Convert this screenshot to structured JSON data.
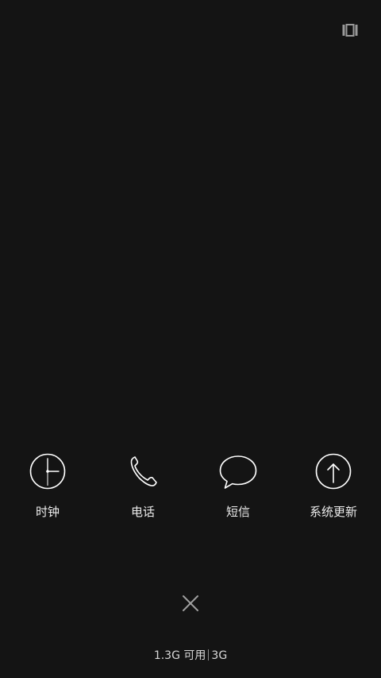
{
  "top_bar": {
    "icon": "app-manager-icon"
  },
  "apps": [
    {
      "label": "时钟",
      "icon": "clock-icon"
    },
    {
      "label": "电话",
      "icon": "phone-icon"
    },
    {
      "label": "短信",
      "icon": "message-icon"
    },
    {
      "label": "系统更新",
      "icon": "update-icon"
    }
  ],
  "close": {
    "icon": "close-icon"
  },
  "memory": {
    "available": "1.3G 可用",
    "total": "3G"
  },
  "colors": {
    "background": "#141414",
    "icon_stroke": "#ffffff",
    "text": "#ececec",
    "muted": "#8a8a8a"
  }
}
